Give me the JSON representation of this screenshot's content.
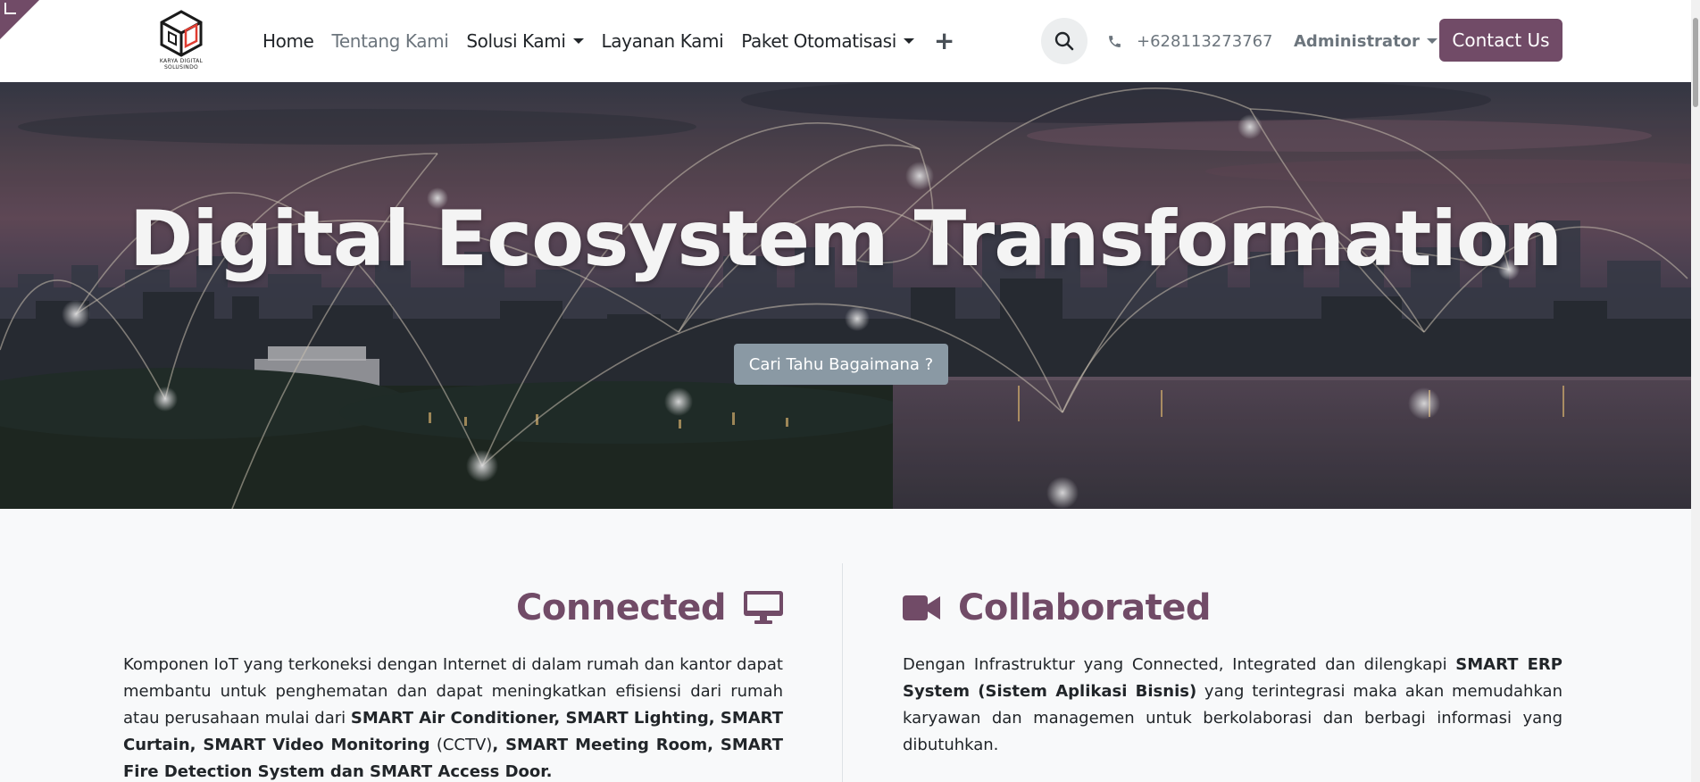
{
  "colors": {
    "brand": "#714b67",
    "hero_button": "#8a99a4",
    "muted": "#6c757d"
  },
  "logo": {
    "icon": "cube-logo-icon",
    "text_line1": "KARYA DIGITAL",
    "text_line2": "SOLUSINDO"
  },
  "nav": {
    "items": [
      {
        "label": "Home",
        "dropdown": false
      },
      {
        "label": "Tentang Kami",
        "dropdown": false,
        "active": true
      },
      {
        "label": "Solusi Kami",
        "dropdown": true
      },
      {
        "label": "Layanan Kami",
        "dropdown": false
      },
      {
        "label": "Paket Otomatisasi",
        "dropdown": true
      }
    ],
    "plus_label": "+"
  },
  "search": {
    "icon": "search-icon"
  },
  "phone": {
    "icon": "phone-icon",
    "number": "+628113273767"
  },
  "user": {
    "label": "Administrator"
  },
  "contact_button": "Contact Us",
  "hero": {
    "title": "Digital Ecosystem Transformation",
    "button": "Cari Tahu Bagaimana ?"
  },
  "features": {
    "connected": {
      "title": "Connected",
      "icon": "monitor-icon",
      "text_parts": [
        {
          "t": "Komponen IoT yang terkoneksi dengan Internet di dalam  rumah dan kantor dapat membantu untuk penghematan dan dapat meningkatkan efisiensi dari rumah atau perusahaan mulai dari ",
          "b": false
        },
        {
          "t": "SMART Air Conditioner, SMART Lighting, SMART Curtain, SMART Video Monitoring",
          "b": true
        },
        {
          "t": " (CCTV)",
          "b": false
        },
        {
          "t": ", SMART Meeting Room, SMART Fire Detection System dan SMART Access Door.",
          "b": true
        }
      ]
    },
    "collaborated": {
      "title": "Collaborated",
      "icon": "video-camera-icon",
      "text_parts": [
        {
          "t": "Dengan Infrastruktur yang Connected, Integrated dan dilengkapi ",
          "b": false
        },
        {
          "t": "SMART ERP System (Sistem Aplikasi Bisnis)",
          "b": true
        },
        {
          "t": " yang terintegrasi maka akan memudahkan karyawan dan managemen untuk berkolaborasi dan berbagi informasi yang dibutuhkan.",
          "b": false
        }
      ]
    }
  }
}
